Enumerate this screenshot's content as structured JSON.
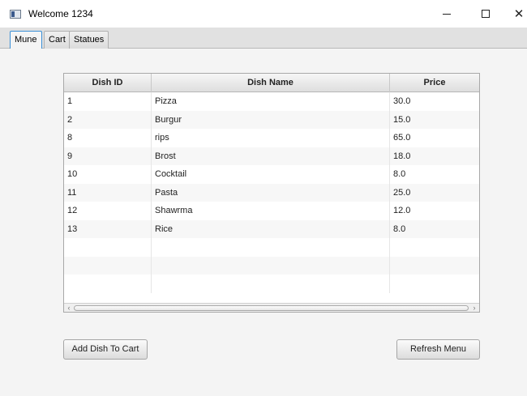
{
  "window": {
    "title": "Welcome 1234",
    "minimize_glyph": "—",
    "close_glyph": "✕"
  },
  "tabs": [
    {
      "label": "Mune",
      "active": true
    },
    {
      "label": "Cart",
      "active": false
    },
    {
      "label": "Statues",
      "active": false
    }
  ],
  "table": {
    "columns": [
      "Dish ID",
      "Dish Name",
      "Price"
    ],
    "rows": [
      [
        "1",
        "Pizza",
        "30.0"
      ],
      [
        "2",
        "Burgur",
        "15.0"
      ],
      [
        "8",
        "rips",
        "65.0"
      ],
      [
        "9",
        "Brost",
        "18.0"
      ],
      [
        "10",
        "Cocktail",
        "8.0"
      ],
      [
        "11",
        "Pasta",
        "25.0"
      ],
      [
        "12",
        "Shawrma",
        "12.0"
      ],
      [
        "13",
        "Rice",
        "8.0"
      ]
    ],
    "empty_rows": 3,
    "scroll_left_glyph": "‹",
    "scroll_right_glyph": "›"
  },
  "buttons": {
    "add_label": "Add Dish To Cart",
    "refresh_label": "Refresh Menu"
  },
  "colors": {
    "accent_tab_border": "#3a8fd6",
    "content_bg": "#f4f4f4"
  }
}
